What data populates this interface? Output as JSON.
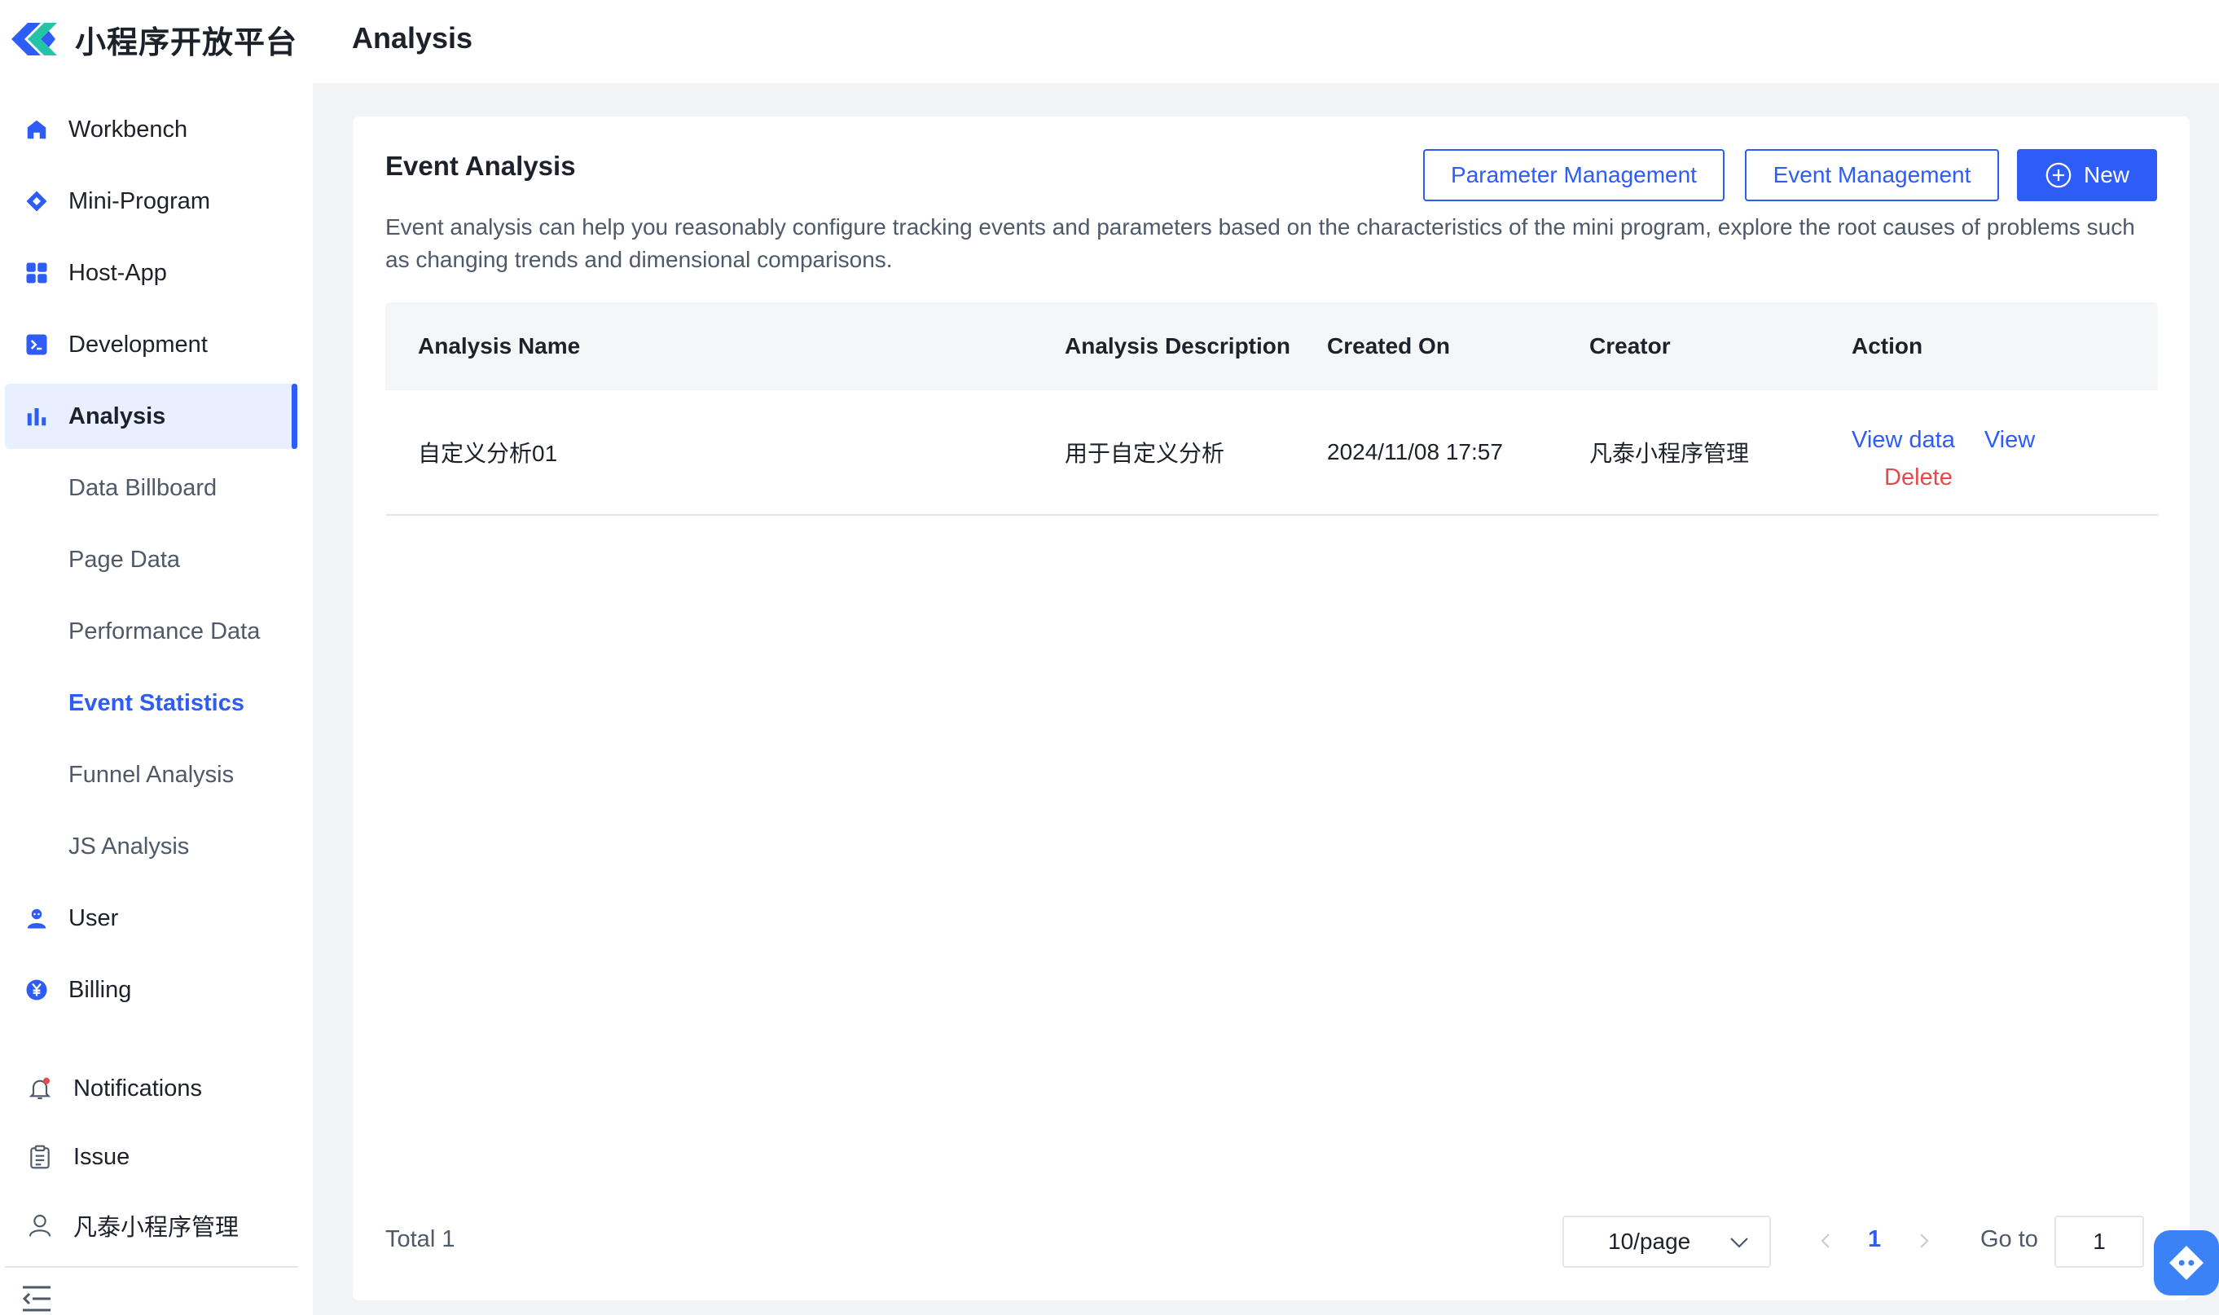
{
  "app": {
    "logo_text": "小程序开放平台"
  },
  "sidebar": {
    "items": [
      {
        "label": "Workbench",
        "icon": "home-icon"
      },
      {
        "label": "Mini-Program",
        "icon": "diamond-icon"
      },
      {
        "label": "Host-App",
        "icon": "grid-icon"
      },
      {
        "label": "Development",
        "icon": "terminal-icon"
      },
      {
        "label": "Analysis",
        "icon": "bar-chart-icon",
        "active": true
      }
    ],
    "sub_items": [
      {
        "label": "Data Billboard"
      },
      {
        "label": "Page Data"
      },
      {
        "label": "Performance Data"
      },
      {
        "label": "Event Statistics",
        "current": true
      },
      {
        "label": "Funnel Analysis"
      },
      {
        "label": "JS Analysis"
      }
    ],
    "after_items": [
      {
        "label": "User",
        "icon": "user-icon"
      },
      {
        "label": "Billing",
        "icon": "yen-icon"
      }
    ],
    "bottom": {
      "notifications": "Notifications",
      "issue": "Issue",
      "account": "凡泰小程序管理"
    }
  },
  "header": {
    "title": "Analysis"
  },
  "card": {
    "title": "Event Analysis",
    "buttons": {
      "parameter_management": "Parameter Management",
      "event_management": "Event Management",
      "new": "New"
    },
    "description": "Event analysis can help you reasonably configure tracking events and parameters based on the characteristics of the mini program, explore the root causes of problems such as changing trends and dimensional comparisons."
  },
  "table": {
    "columns": [
      "Analysis Name",
      "Analysis Description",
      "Created On",
      "Creator",
      "Action"
    ],
    "rows": [
      {
        "name": "自定义分析01",
        "description": "用于自定义分析",
        "created_on": "2024/11/08 17:57",
        "creator": "凡泰小程序管理",
        "actions": {
          "view_data": "View data",
          "view": "View",
          "delete": "Delete"
        }
      }
    ]
  },
  "pagination": {
    "total": "Total 1",
    "page_size": "10/page",
    "current_page": "1",
    "goto_label": "Go to",
    "goto_value": "1"
  },
  "colors": {
    "accent": "#2d5cf6",
    "danger": "#e5484d",
    "active_bg": "#e8f0ff"
  }
}
